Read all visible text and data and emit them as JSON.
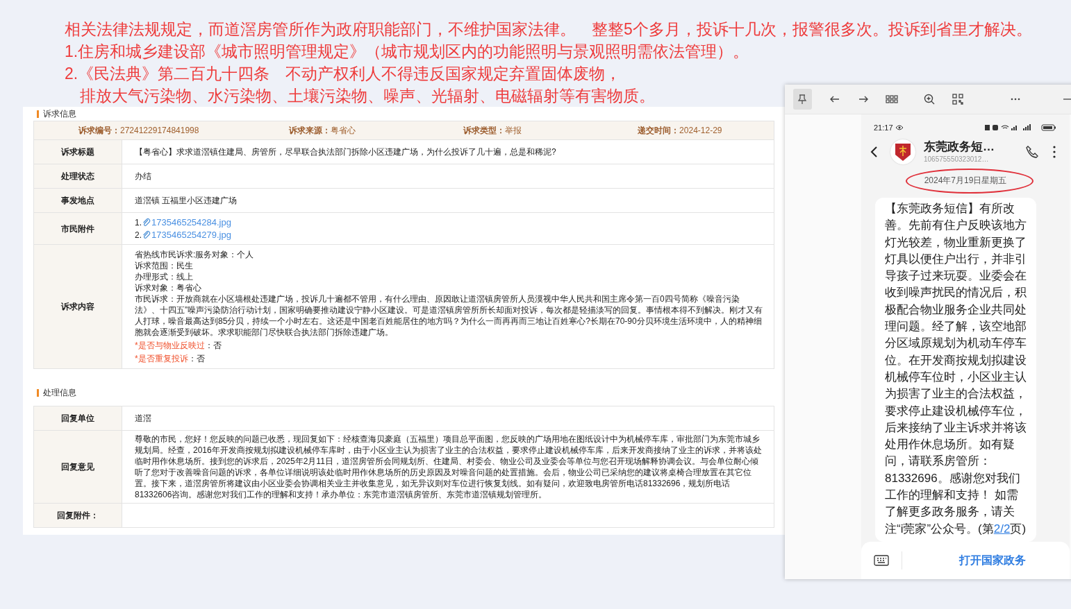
{
  "annotation": {
    "lines": [
      {
        "text": "相关法律法规规定，而道滘房管所作为政府职能部门，不维护国家法律。　整整5个多月，投诉十几次，报警很多次。投诉到省里才解决。",
        "kind": "line"
      },
      {
        "text": "1.住房和城乡建设部《城市照明管理规定》（城市规划区内的功能照明与景观照明需依法管理）。",
        "kind": "line"
      },
      {
        "text": "2.《民法典》第二百九十四条　不动产权利人不得违反国家规定弃置固体废物，",
        "kind": "line"
      },
      {
        "text": "排放大气污染物、水污染物、土壤污染物、噪声、光辐射、电磁辐射等有害物质。",
        "kind": "continuation"
      }
    ]
  },
  "complaint": {
    "title": "诉求信息",
    "meta": [
      {
        "label": "诉求编号：",
        "value": "27241229174841998"
      },
      {
        "label": "诉求来源：",
        "value": "粤省心"
      },
      {
        "label": "诉求类型：",
        "value": "举报"
      },
      {
        "label": "递交时间：",
        "value": "2024-12-29"
      }
    ],
    "rows": [
      {
        "kind": "text",
        "label": "诉求标题",
        "value": "【粤省心】求求道滘镇住建局、房管所，尽早联合执法部门拆除小区违建广场，为什么投诉了几十遍，总是和稀泥?"
      },
      {
        "kind": "text",
        "label": "处理状态",
        "value": "办结"
      },
      {
        "kind": "text",
        "label": "事发地点",
        "value": "道滘镇 五福里小区违建广场"
      },
      {
        "kind": "attachments",
        "label": "市民附件",
        "files": [
          {
            "index": "1.",
            "name": "1735465254284.jpg"
          },
          {
            "index": "2.",
            "name": "1735465254279.jpg"
          }
        ]
      },
      {
        "kind": "content",
        "label": "诉求内容",
        "lines": [
          {
            "kind": "plain",
            "text": "省热线市民诉求:服务对象：个人"
          },
          {
            "kind": "plain",
            "text": "诉求范围：民生"
          },
          {
            "kind": "plain",
            "text": "办理形式：线上"
          },
          {
            "kind": "plain",
            "text": "诉求对象：粤省心"
          },
          {
            "kind": "plain",
            "text": "市民诉求：开放商就在小区墙根处违建广场，投诉几十遍都不管用，有什么理由、原因敢让道滘镇房管所人员漠视中华人民共和国主席令第一百0四号简称《噪音污染法》、十四五”噪声污染防治行动计划，国家明确要推动建设宁静小区建设。可是道滘镇房管所所长却面对投诉，每次都是轻描淡写的回复。事情根本得不到解决。刚才又有人打球，噪音最高达到85分贝，持续一个小时左右。这还是中国老百姓能居住的地方吗？为什么一而再再而三地让百姓寒心?长期在70-90分贝环境生活环境中，人的精神细胞就会逐渐受到破坏。求求职能部门尽快联合执法部门拆除违建广场。"
          },
          {
            "kind": "flag",
            "label": "*是否与物业反映过",
            "value": "：否"
          },
          {
            "kind": "flag",
            "label": "*是否重复投诉",
            "value": "：否"
          }
        ]
      }
    ]
  },
  "handling": {
    "title": "处理信息",
    "rows": [
      {
        "label": "回复单位",
        "value": "道滘"
      },
      {
        "label": "回复意见",
        "value": "尊敬的市民，您好！您反映的问题已收悉，现回复如下：经核查海贝豪庭（五福里）项目总平面图，您反映的广场用地在图纸设计中为机械停车库，审批部门为东莞市城乡规划局。经查，2016年开发商按规划拟建设机械停车库时，由于小区业主认为损害了业主的合法权益，要求停止建设机械停车库，后来开发商接纳了业主的诉求，并将该处临时用作休息场所。接到您的诉求后，2025年2月11日，道滘房管所会同规划所、住建局、村委会、物业公司及业委会等单位与您召开现场解释协调会议。与会单位耐心倾听了您对于改善噪音问题的诉求，各单位详细说明该处临时用作休息场所的历史原因及对噪音问题的处置措施。会后，物业公司已采纳您的建议将桌椅合理放置在其它位置。接下来，道滘房管所将建议由小区业委会协调相关业主并收集意见，如无异议则对车位进行恢复划线。如有疑问，欢迎致电房管所电话81332696，规划所电话81332606咨询。感谢您对我们工作的理解和支持！承办单位：东莞市道滘镇房管所、东莞市道滘镇规划管理所。"
      },
      {
        "label": "回复附件："
      }
    ]
  },
  "viewer": {
    "toolbar": [
      {
        "kind": "pin",
        "selected": true
      },
      {
        "kind": "back",
        "selected": false
      },
      {
        "kind": "forward",
        "selected": false
      },
      {
        "kind": "grid",
        "selected": false
      },
      {
        "kind": "zoom",
        "selected": false
      },
      {
        "kind": "qr",
        "selected": false
      },
      {
        "kind": "more",
        "selected": false
      },
      {
        "kind": "minimize",
        "selected": false
      }
    ],
    "phone": {
      "time": "21:17",
      "contact": "东莞政务短…",
      "number": "106575550323012…",
      "date": "2024年7月19日星期五",
      "message": {
        "text": "【东莞政务短信】有所改善。先前有住户反映该地方灯光较差，物业重新更换了灯具以便住户出行，并非引导孩子过来玩耍。业委会在收到噪声扰民的情况后，积极配合物业服务企业共同处理问题。经了解，该空地部分区域原规划为机动车停车位。在开发商按规划拟建设机械停车位时，小区业主认为损害了业主的合法权益，要求停止建设机械停车位，后来接纳了业主诉求并将该处用作休息场所。如有疑问，请联系房管所：81332696。感谢您对我们工作的理解和支持！ 如需了解更多政务服务，请关注“i莞家”公众号。(第",
        "link": "2/2",
        "suffix": "页)"
      },
      "action": "打开国家政务"
    }
  }
}
